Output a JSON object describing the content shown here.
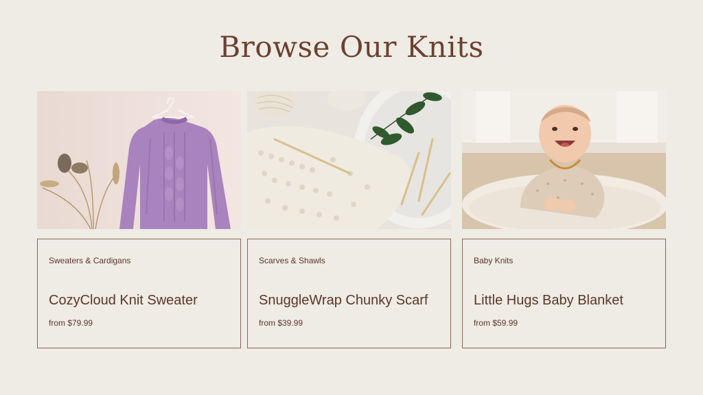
{
  "page": {
    "title": "Browse Our Knits"
  },
  "products": [
    {
      "category": "Sweaters & Cardigans",
      "name": "CozyCloud Knit Sweater",
      "price": "from $79.99",
      "image_icon": "purple-sweater-photo"
    },
    {
      "category": "Scarves & Shawls",
      "name": "SnuggleWrap Chunky Scarf",
      "price": "from $39.99",
      "image_icon": "cream-knit-scarf-photo"
    },
    {
      "category": "Baby Knits",
      "name": "Little Hugs Baby Blanket",
      "price": "from $59.99",
      "image_icon": "baby-on-rug-photo"
    }
  ],
  "colors": {
    "background": "#efebe5",
    "text": "#5a3726",
    "border": "#8a6556"
  }
}
